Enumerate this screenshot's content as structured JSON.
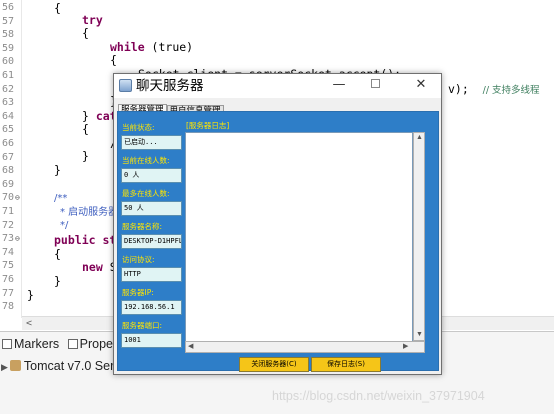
{
  "editor": {
    "line_numbers": [
      "56",
      "57",
      "58",
      "59",
      "60",
      "61",
      "62",
      "63",
      "64",
      "65",
      "66",
      "67",
      "68",
      "69",
      "70",
      "71",
      "72",
      "73",
      "74",
      "75",
      "76",
      "77",
      "78"
    ],
    "fold_markers": [
      "70",
      "73"
    ],
    "code": {
      "l56": "{",
      "l57": "try",
      "l58": "{",
      "l59_kw": "while",
      "l59_rest": " (true)",
      "l60": "{",
      "l61": "Socket client = serverSocket.accept();",
      "l62_code": "v);",
      "l62_comment": "// 支持多线程",
      "l63": "}",
      "l64_brace": "}",
      "l64_kw": "cat",
      "l65": "{",
      "l66": "/",
      "l67": "}",
      "l68": "}",
      "l70": "/**",
      "l71": "* 启动服务器",
      "l72": "*/",
      "l73_kw": "public st",
      "l74": "{",
      "l75_kw": "new",
      "l75_rest": " S",
      "l76": "}",
      "l77": "}"
    }
  },
  "views": {
    "tabs": [
      {
        "label": "Markers",
        "icon": "markers-icon"
      },
      {
        "label": "Properti",
        "icon": "properties-icon"
      }
    ],
    "server_row": "Tomcat v7.0 Serve"
  },
  "window": {
    "title": "聊天服务器",
    "tabs": [
      "服务器管理",
      "用户信息管理"
    ],
    "fields": [
      {
        "label": "当前状态:",
        "value": "已启动..."
      },
      {
        "label": "当前在线人数:",
        "value": "0 人"
      },
      {
        "label": "最多在线人数:",
        "value": "50 人"
      },
      {
        "label": "服务器名称:",
        "value": "DESKTOP-D1HPFL"
      },
      {
        "label": "访问协议:",
        "value": "HTTP"
      },
      {
        "label": "服务器IP:",
        "value": "192.168.56.1"
      },
      {
        "label": "服务器端口:",
        "value": "1001"
      }
    ],
    "log_label": "[服务器日志]",
    "buttons": {
      "close_server": "关闭服务器(C)",
      "save_log": "保存日志(S)"
    },
    "accent_color": "#2e7ec8",
    "label_color": "#ffe500",
    "button_color": "#f5c518"
  },
  "watermark": "https://blog.csdn.net/weixin_37971904"
}
